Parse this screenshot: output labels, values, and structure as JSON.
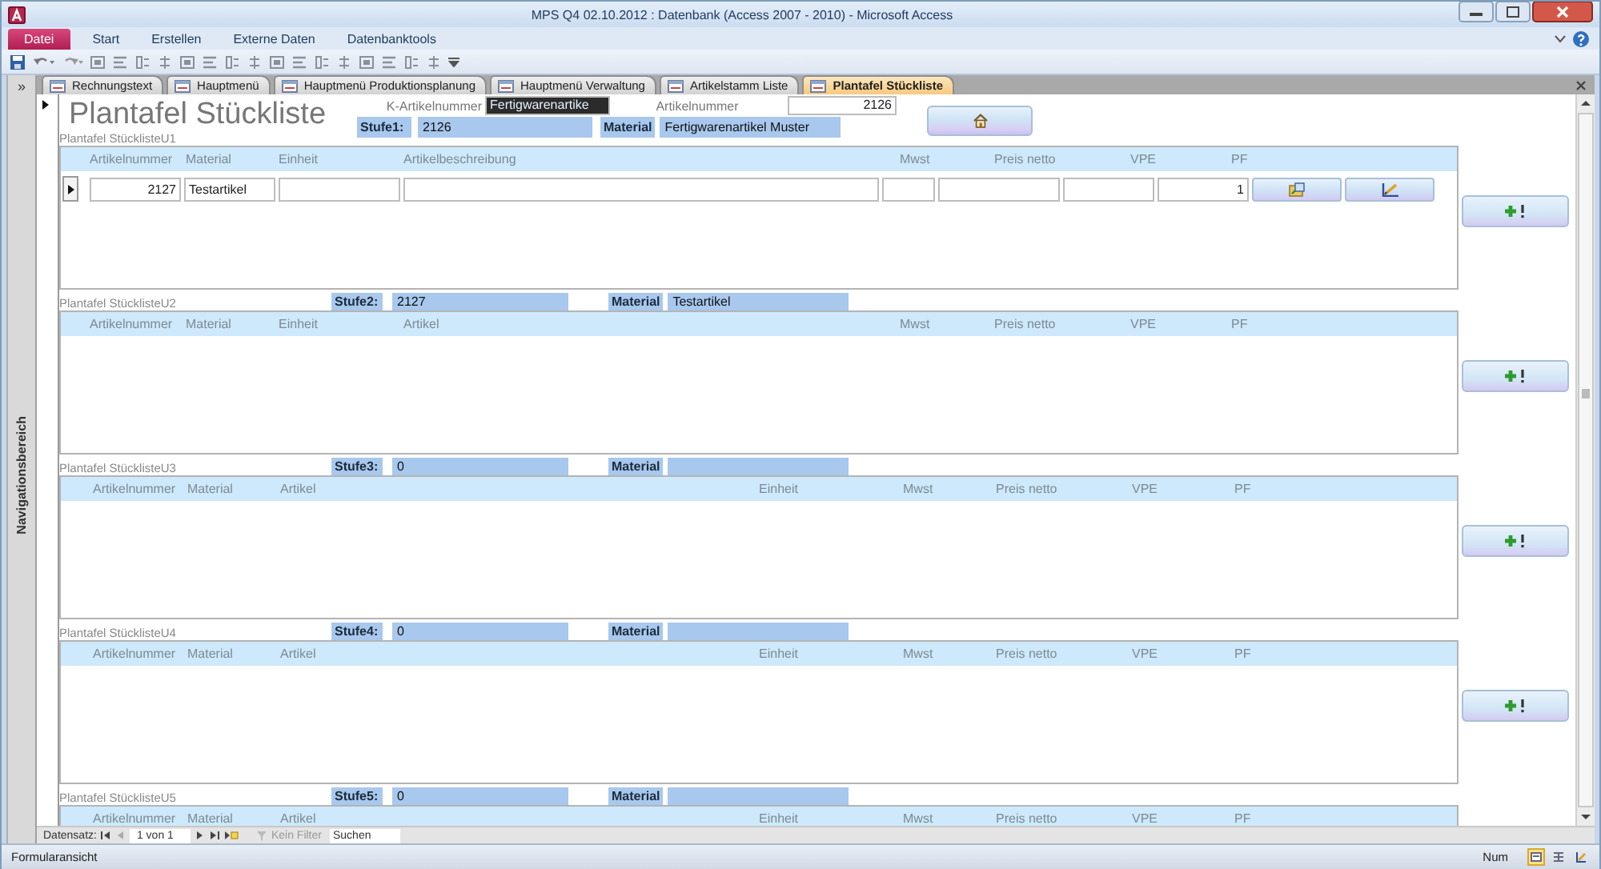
{
  "window": {
    "title": "MPS Q4 02.10.2012 : Datenbank (Access 2007 - 2010)  -  Microsoft Access"
  },
  "ribbon": {
    "file_tab": "Datei",
    "tabs": [
      "Start",
      "Erstellen",
      "Externe Daten",
      "Datenbanktools"
    ]
  },
  "navigation_pane": {
    "toggle": "»",
    "label": "Navigationsbereich"
  },
  "document_tabs": [
    {
      "label": "Rechnungstext",
      "selected": false
    },
    {
      "label": "Hauptmenü",
      "selected": false
    },
    {
      "label": "Hauptmenü Produktionsplanung",
      "selected": false
    },
    {
      "label": "Hauptmenü Verwaltung",
      "selected": false
    },
    {
      "label": "Artikelstamm Liste",
      "selected": false
    },
    {
      "label": "Plantafel Stückliste",
      "selected": true
    }
  ],
  "form": {
    "title": "Plantafel Stückliste",
    "fields": [
      {
        "label": "K-Artikelnummer",
        "value": "Fertigwarenartike",
        "text_selected": true
      },
      {
        "label": "Artikelnummer",
        "value": "2126",
        "text_selected": false
      }
    ],
    "stufe": {
      "label": "Stufe1:",
      "value": "2126"
    },
    "material": {
      "label": "Material",
      "value": "Fertigwarenartikel Muster"
    }
  },
  "subforms": [
    {
      "caption": "Plantafel StücklisteU1",
      "kind": "description",
      "columns": [
        "Artikelnummer",
        "Material",
        "Einheit",
        "Artikelbeschreibung",
        "Mwst",
        "Preis netto",
        "VPE",
        "PF"
      ],
      "rows": [
        {
          "current": true,
          "cells": [
            {
              "value": "2127"
            },
            {
              "value": "Testartikel"
            },
            {},
            {},
            {},
            {},
            {},
            {
              "value": "1"
            }
          ]
        }
      ]
    },
    {
      "caption": "Plantafel StücklisteU2",
      "stufe": {
        "label": "Stufe2:",
        "value": "2127"
      },
      "material": {
        "label": "Material",
        "value": "Testartikel"
      },
      "kind": "description",
      "columns": [
        "Artikelnummer",
        "Material",
        "Einheit",
        "Artikel",
        "Mwst",
        "Preis netto",
        "VPE",
        "PF"
      ]
    },
    {
      "caption": "Plantafel StücklisteU3",
      "stufe": {
        "label": "Stufe3:",
        "value": "0"
      },
      "material": {
        "label": "Material"
      },
      "kind": "article",
      "columns": [
        "Artikelnummer",
        "Material",
        "Artikel",
        "Einheit",
        "Mwst",
        "Preis netto",
        "VPE",
        "PF"
      ]
    },
    {
      "caption": "Plantafel StücklisteU4",
      "stufe": {
        "label": "Stufe4:",
        "value": "0"
      },
      "material": {
        "label": "Material"
      },
      "kind": "article",
      "columns": [
        "Artikelnummer",
        "Material",
        "Artikel",
        "Einheit",
        "Mwst",
        "Preis netto",
        "VPE",
        "PF"
      ]
    },
    {
      "caption": "Plantafel StücklisteU5",
      "stufe": {
        "label": "Stufe5:",
        "value": "0"
      },
      "material": {
        "label": "Material"
      },
      "kind": "article",
      "columns": [
        "Artikelnummer",
        "Material",
        "Artikel",
        "Einheit",
        "Mwst",
        "Preis netto",
        "VPE",
        "PF"
      ]
    }
  ],
  "record_navigation": {
    "label": "Datensatz:",
    "position": "1 von 1",
    "filter": "Kein Filter",
    "search_placeholder": "Suchen"
  },
  "status_bar": {
    "text": "Formularansicht",
    "indicator": "Num",
    "views": [
      {
        "selected": true
      },
      {
        "selected": false
      },
      {
        "selected": false
      }
    ]
  }
}
